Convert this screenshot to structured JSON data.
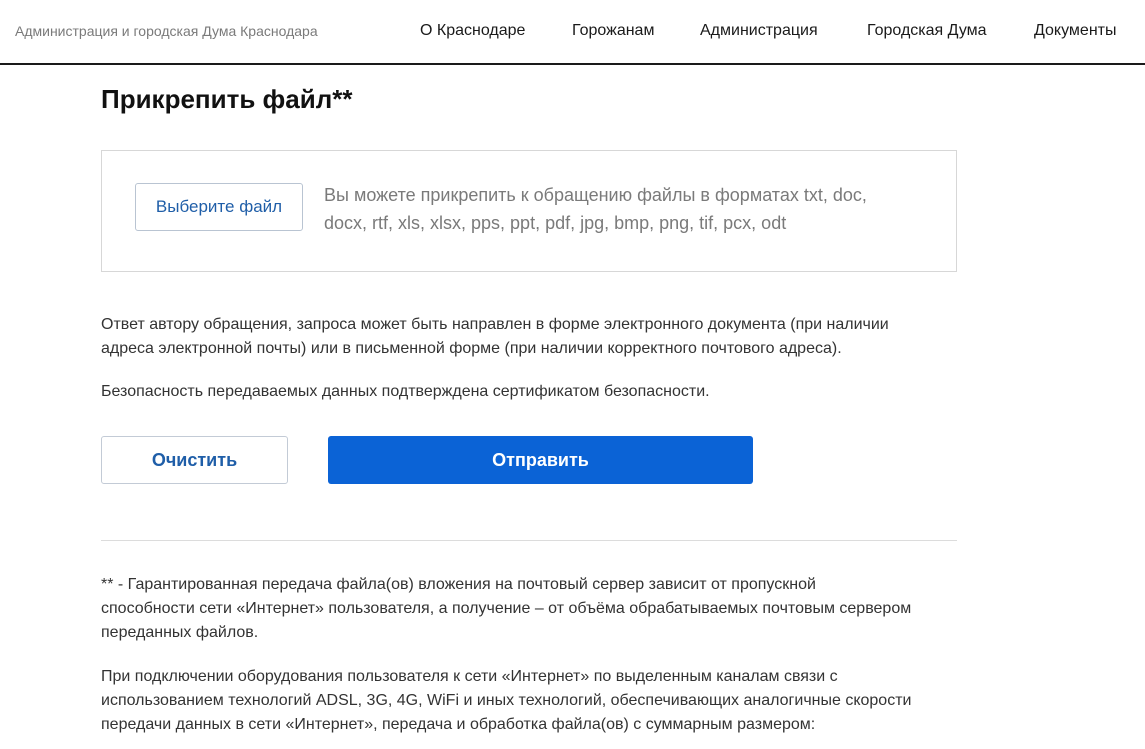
{
  "header": {
    "brand": "Администрация и городская Дума Краснодара",
    "nav": [
      "О Краснодаре",
      "Горожанам",
      "Администрация",
      "Городская Дума",
      "Документы"
    ]
  },
  "attach": {
    "title": "Прикрепить файл**",
    "file_button": "Выберите файл",
    "hint_line1": "Вы можете прикрепить к обращению файлы в форматах txt, doc,",
    "hint_line2": "docx, rtf, xls, xlsx, pps, ppt, pdf, jpg, bmp, png, tif, pcx, odt"
  },
  "info": {
    "reply_line1": "Ответ автору обращения, запроса может быть направлен в форме электронного документа (при наличии",
    "reply_line2": "адреса электронной почты) или в письменной форме (при наличии корректного почтового адреса).",
    "security": "Безопасность передаваемых данных подтверждена сертификатом безопасности."
  },
  "actions": {
    "clear": "Очистить",
    "send": "Отправить"
  },
  "footnote": {
    "p1_line1": "** - Гарантированная передача файла(ов) вложения на почтовый сервер зависит от пропускной",
    "p1_line2": "способности сети «Интернет» пользователя, а получение – от объёма обрабатываемых почтовым сервером",
    "p1_line3": "переданных файлов.",
    "p2_line1": "При подключении оборудования пользователя к сети «Интернет» по выделенным каналам связи с",
    "p2_line2": "использованием технологий ADSL, 3G, 4G, WiFi и иных технологий, обеспечивающих аналогичные скорости",
    "p2_line3": "передачи данных в сети «Интернет», передача и обработка файла(ов) с суммарным размером:"
  },
  "colors": {
    "primary": "#0b63d6",
    "link": "#1f5ea8"
  }
}
